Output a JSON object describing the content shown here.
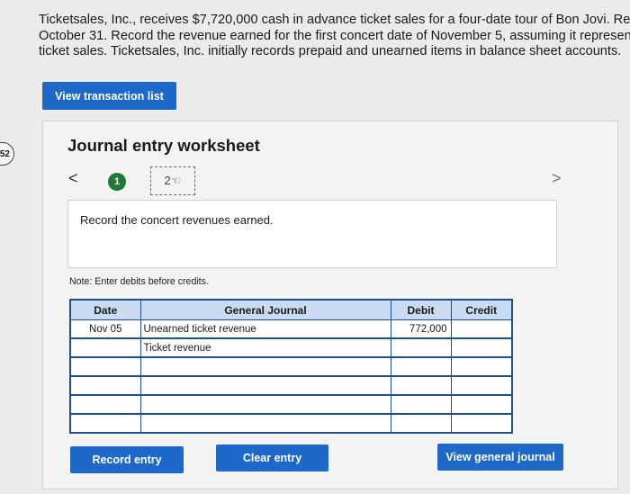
{
  "problem": {
    "line1": "Ticketsales, Inc., receives $7,720,000 cash in advance ticket sales for a four-date tour of Bon Jovi. Reco",
    "line2": "October 31. Record the revenue earned for the first concert date of November 5, assuming it represent",
    "line3": "ticket sales. Ticketsales, Inc. initially records prepaid and unearned items in balance sheet accounts."
  },
  "side_badge": "52",
  "buttons": {
    "view_transactions": "View transaction list",
    "record_entry": "Record entry",
    "clear_entry": "Clear entry",
    "view_general_journal": "View general journal"
  },
  "worksheet": {
    "title": "Journal entry worksheet",
    "nav_prev": "<",
    "nav_next": ">",
    "steps": [
      "1",
      "2"
    ],
    "instruction": "Record the concert revenues earned.",
    "note": "Note: Enter debits before credits."
  },
  "journal": {
    "headers": [
      "Date",
      "General Journal",
      "Debit",
      "Credit"
    ],
    "rows": [
      {
        "date": "Nov 05",
        "account": "Unearned ticket revenue",
        "debit": "772,000",
        "credit": ""
      },
      {
        "date": "",
        "account": "Ticket revenue",
        "debit": "",
        "credit": ""
      },
      {
        "date": "",
        "account": "",
        "debit": "",
        "credit": ""
      },
      {
        "date": "",
        "account": "",
        "debit": "",
        "credit": ""
      },
      {
        "date": "",
        "account": "",
        "debit": "",
        "credit": ""
      },
      {
        "date": "",
        "account": "",
        "debit": "",
        "credit": ""
      }
    ]
  },
  "colors": {
    "primary_button": "#1d68c9",
    "table_header": "#c9daf1",
    "table_border": "#1f4f8f",
    "step_active": "#1f7a3a"
  }
}
